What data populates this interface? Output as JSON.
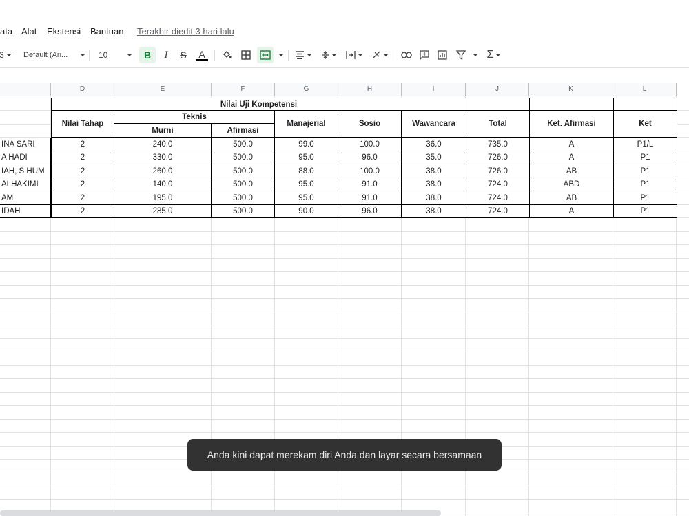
{
  "menu": {
    "items": [
      "ata",
      "Alat",
      "Ekstensi",
      "Bantuan"
    ],
    "last_edit": "Terakhir diedit 3 hari lalu"
  },
  "toolbar": {
    "partial": "3",
    "font": "Default (Ari...",
    "font_size": "10",
    "bold": "B",
    "italic": "I",
    "strike": "S",
    "text_color": "A",
    "sum": "Σ"
  },
  "columns": [
    "D",
    "E",
    "F",
    "G",
    "H",
    "I",
    "J",
    "K",
    "L"
  ],
  "table": {
    "group_header": "Nilai Uji Kompetensi",
    "teknis": "Teknis",
    "headers": {
      "nilai_tahap": "Nilai Tahap",
      "murni": "Murni",
      "afirmasi": "Afirmasi",
      "manajerial": "Manajerial",
      "sosio": "Sosio",
      "wawancara": "Wawancara",
      "total": "Total",
      "ket_afirmasi": "Ket. Afirmasi",
      "ket": "Ket"
    },
    "rows": [
      [
        "INA SARI",
        "2",
        "240.0",
        "500.0",
        "99.0",
        "100.0",
        "36.0",
        "735.0",
        "A",
        "P1/L"
      ],
      [
        "A HADI",
        "2",
        "330.0",
        "500.0",
        "95.0",
        "96.0",
        "35.0",
        "726.0",
        "A",
        "P1"
      ],
      [
        "IAH, S.HUM",
        "2",
        "260.0",
        "500.0",
        "88.0",
        "100.0",
        "38.0",
        "726.0",
        "AB",
        "P1"
      ],
      [
        "ALHAKIMI",
        "2",
        "140.0",
        "500.0",
        "95.0",
        "91.0",
        "38.0",
        "724.0",
        "ABD",
        "P1"
      ],
      [
        "AM",
        "2",
        "195.0",
        "500.0",
        "95.0",
        "91.0",
        "38.0",
        "724.0",
        "AB",
        "P1"
      ],
      [
        "IDAH",
        "2",
        "285.0",
        "500.0",
        "90.0",
        "96.0",
        "38.0",
        "724.0",
        "A",
        "P1"
      ]
    ]
  },
  "toast": "Anda kini dapat merekam diri Anda dan layar secara bersamaan",
  "colors": {
    "active_green": "#188038",
    "toast_bg": "#323232"
  }
}
